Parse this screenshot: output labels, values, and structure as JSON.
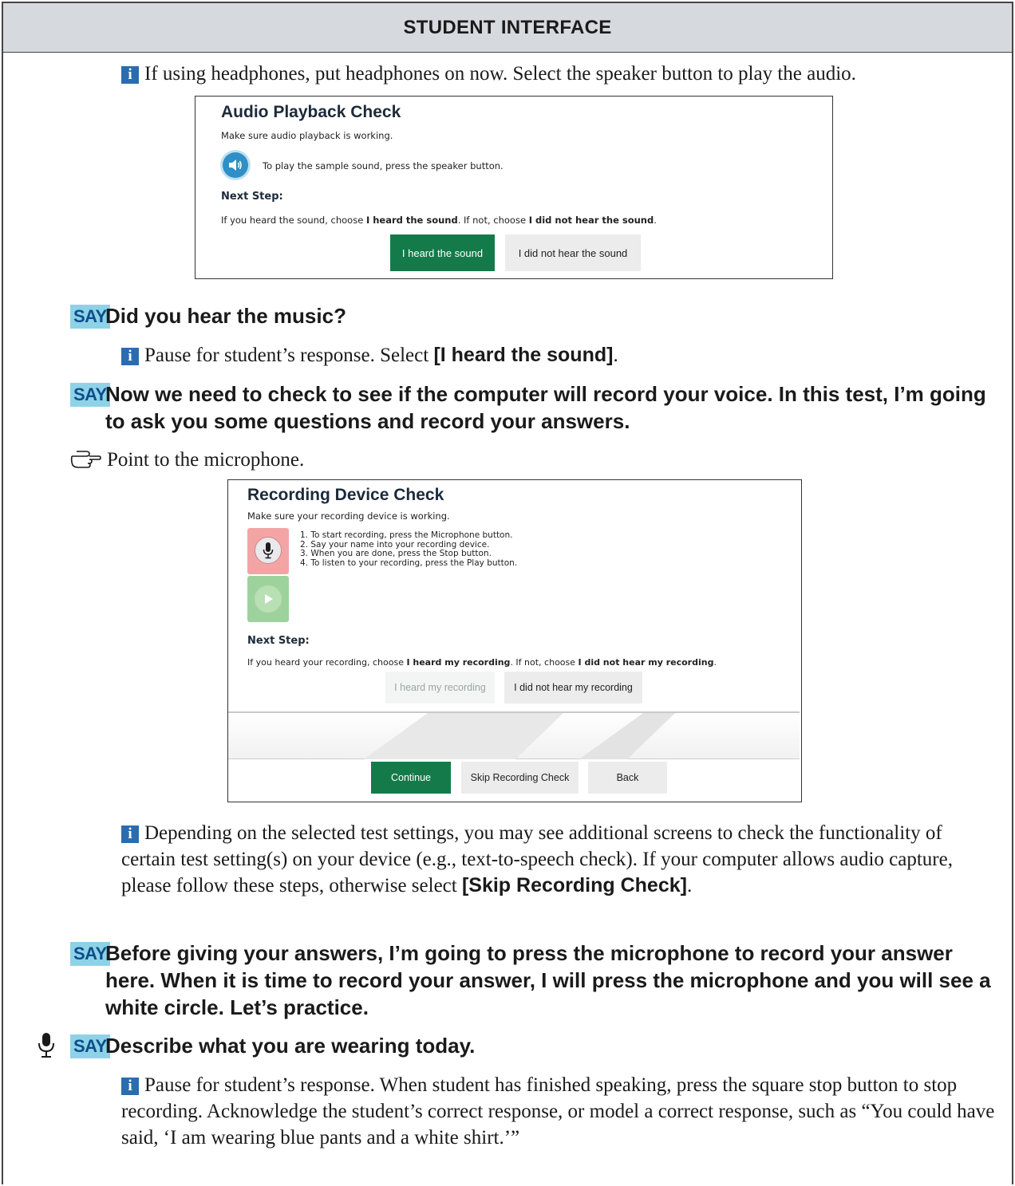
{
  "header": {
    "title": "STUDENT INTERFACE"
  },
  "intro_note": "If using headphones, put headphones on now. Select the speaker button to play the audio.",
  "audio_check": {
    "title": "Audio Playback Check",
    "subtitle": "Make sure audio playback is working.",
    "speaker_instruction": "To play the sample sound, press the speaker button.",
    "next_step_label": "Next Step:",
    "next_step_text_1": "If you heard the sound, choose ",
    "next_step_bold_1": "I heard the sound",
    "next_step_text_2": ". If not, choose ",
    "next_step_bold_2": "I did not hear the sound",
    "next_step_text_3": ".",
    "heard_button": "I heard the sound",
    "not_heard_button": "I did not hear the sound"
  },
  "say1": {
    "badge": "SAY",
    "text": "Did you hear the music?"
  },
  "note2": {
    "text": "Pause for student’s response. Select ",
    "bold": "[I heard the sound]",
    "end": "."
  },
  "say2": {
    "badge": "SAY",
    "text": "Now we need to check to see if the computer will record your voice. In this test, I’m going to ask you some questions and record your answers."
  },
  "point_instruction": "Point to the microphone.",
  "recording_check": {
    "title": "Recording Device Check",
    "subtitle": "Make sure your recording device is working.",
    "steps": [
      "1. To start recording, press the Microphone button.",
      "2. Say your name into your recording device.",
      "3. When you are done, press the Stop button.",
      "4. To listen to your recording, press the Play button."
    ],
    "next_step_label": "Next Step:",
    "next_step_text_1": "If you heard your recording, choose ",
    "next_step_bold_1": "I heard my recording",
    "next_step_text_2": ". If not, choose ",
    "next_step_bold_2": "I did not hear my recording",
    "next_step_text_3": ".",
    "heard_button": "I heard my recording",
    "not_heard_button": "I did not hear my recording",
    "continue_button": "Continue",
    "skip_button": "Skip Recording Check",
    "back_button": "Back"
  },
  "note3": {
    "text": "Depending on the selected test settings, you may see additional screens to check the functionality of certain test setting(s) on your device (e.g., text-to-speech check). If your computer allows audio capture, please follow these steps, otherwise select ",
    "bold": "[Skip Recording Check]",
    "end": "."
  },
  "say3": {
    "badge": "SAY",
    "text": "Before giving your answers, I’m going to press the microphone to record your answer here. When it is time to record your answer, I will press the microphone and you will see a white circle. Let’s practice."
  },
  "say4": {
    "badge": "SAY",
    "text": "Describe what you are wearing today."
  },
  "note4": "Pause for student’s response. When student has finished speaking, press the square stop button to stop recording. Acknowledge the student’s correct response, or model a correct response, such as “You could have said, ‘I am wearing blue pants and a white shirt.’”",
  "colors": {
    "info_blue": "#2b6cb0",
    "say_badge_bg": "#8fd2e8",
    "button_green": "#157a4a",
    "header_gray": "#d6d9de"
  }
}
